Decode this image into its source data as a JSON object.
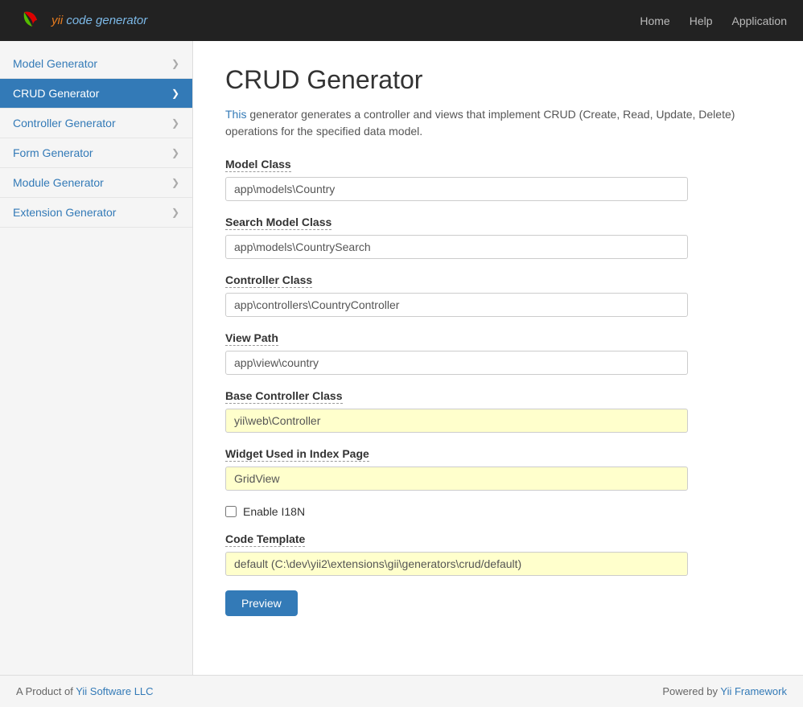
{
  "header": {
    "logo_text": "yii",
    "logo_subtext": " code generator",
    "nav": {
      "home": "Home",
      "help": "Help",
      "application": "Application"
    }
  },
  "sidebar": {
    "items": [
      {
        "id": "model-generator",
        "label": "Model Generator",
        "active": false
      },
      {
        "id": "crud-generator",
        "label": "CRUD Generator",
        "active": true
      },
      {
        "id": "controller-generator",
        "label": "Controller Generator",
        "active": false
      },
      {
        "id": "form-generator",
        "label": "Form Generator",
        "active": false
      },
      {
        "id": "module-generator",
        "label": "Module Generator",
        "active": false
      },
      {
        "id": "extension-generator",
        "label": "Extension Generator",
        "active": false
      }
    ]
  },
  "main": {
    "page_title": "CRUD Generator",
    "description_part1": "This",
    "description_part2": " generator generates a controller and views that implement CRUD (Create, Read, Update, Delete) operations for the specified data model.",
    "description_link_text": "This",
    "form": {
      "model_class": {
        "label": "Model Class",
        "value": "app\\models\\Country",
        "placeholder": "app\\models\\Country"
      },
      "search_model_class": {
        "label": "Search Model Class",
        "value": "app\\models\\CountrySearch",
        "placeholder": "app\\models\\CountrySearch"
      },
      "controller_class": {
        "label": "Controller Class",
        "value": "app\\controllers\\CountryController",
        "placeholder": "app\\controllers\\CountryController"
      },
      "view_path": {
        "label": "View Path",
        "value": "app\\view\\country",
        "placeholder": "app\\view\\country"
      },
      "base_controller_class": {
        "label": "Base Controller Class",
        "value": "yii\\web\\Controller",
        "placeholder": "yii\\web\\Controller"
      },
      "widget_used": {
        "label": "Widget Used in Index Page",
        "value": "GridView",
        "placeholder": "GridView"
      },
      "enable_i18n": {
        "label": "Enable I18N",
        "checked": false
      },
      "code_template": {
        "label": "Code Template",
        "value": "default (C:\\dev\\yii2\\extensions\\gii\\generators\\crud/default)"
      },
      "preview_button": "Preview"
    }
  },
  "footer": {
    "left_text": "A Product of ",
    "left_link_text": "Yii Software LLC",
    "right_text": "Powered by ",
    "right_link_text": "Yii Framework"
  }
}
